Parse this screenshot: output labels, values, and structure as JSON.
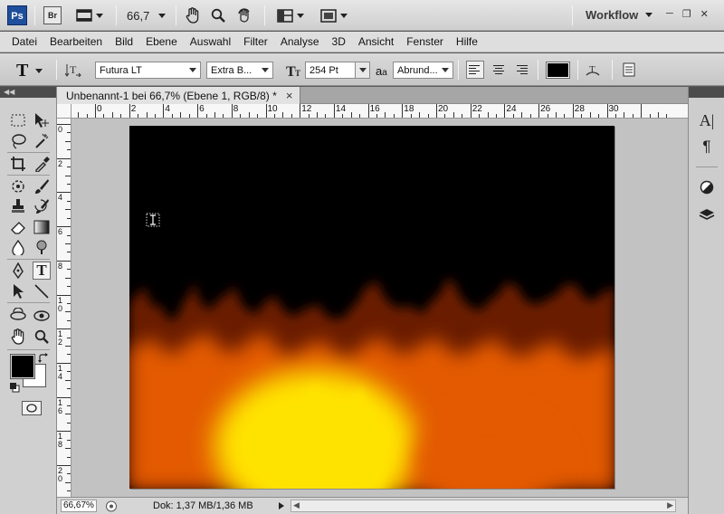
{
  "appbar": {
    "ps_logo": "Ps",
    "br_logo": "Br",
    "zoom": "66,7",
    "workspace": "Workflow"
  },
  "menu": [
    "Datei",
    "Bearbeiten",
    "Bild",
    "Ebene",
    "Auswahl",
    "Filter",
    "Analyse",
    "3D",
    "Ansicht",
    "Fenster",
    "Hilfe"
  ],
  "options": {
    "tool_glyph": "T",
    "font_family": "Futura LT",
    "font_style": "Extra B...",
    "font_size": "254 Pt",
    "antialias": "Abrund...",
    "text_color": "#000000"
  },
  "document": {
    "tab_title": "Unbenannt-1 bei 66,7% (Ebene 1, RGB/8) *",
    "close_glyph": "×"
  },
  "ruler": {
    "h_labels": [
      "2",
      "0",
      "2",
      "4",
      "6",
      "8",
      "10",
      "12",
      "14",
      "16",
      "18",
      "20",
      "22",
      "24",
      "26",
      "28",
      "30"
    ],
    "v_labels": [
      "0",
      "2",
      "4",
      "6",
      "8",
      "1\n0",
      "1\n2",
      "1\n4",
      "1\n6",
      "1\n8",
      "2\n0"
    ]
  },
  "status": {
    "zoom": "66,67%",
    "doc_info": "Dok: 1,37 MB/1,36 MB"
  },
  "colors": {
    "foreground": "#000000",
    "background": "#ffffff",
    "fire_deep": "#6b1a00",
    "fire_mid": "#e35a00",
    "fire_hot": "#ffe300"
  }
}
